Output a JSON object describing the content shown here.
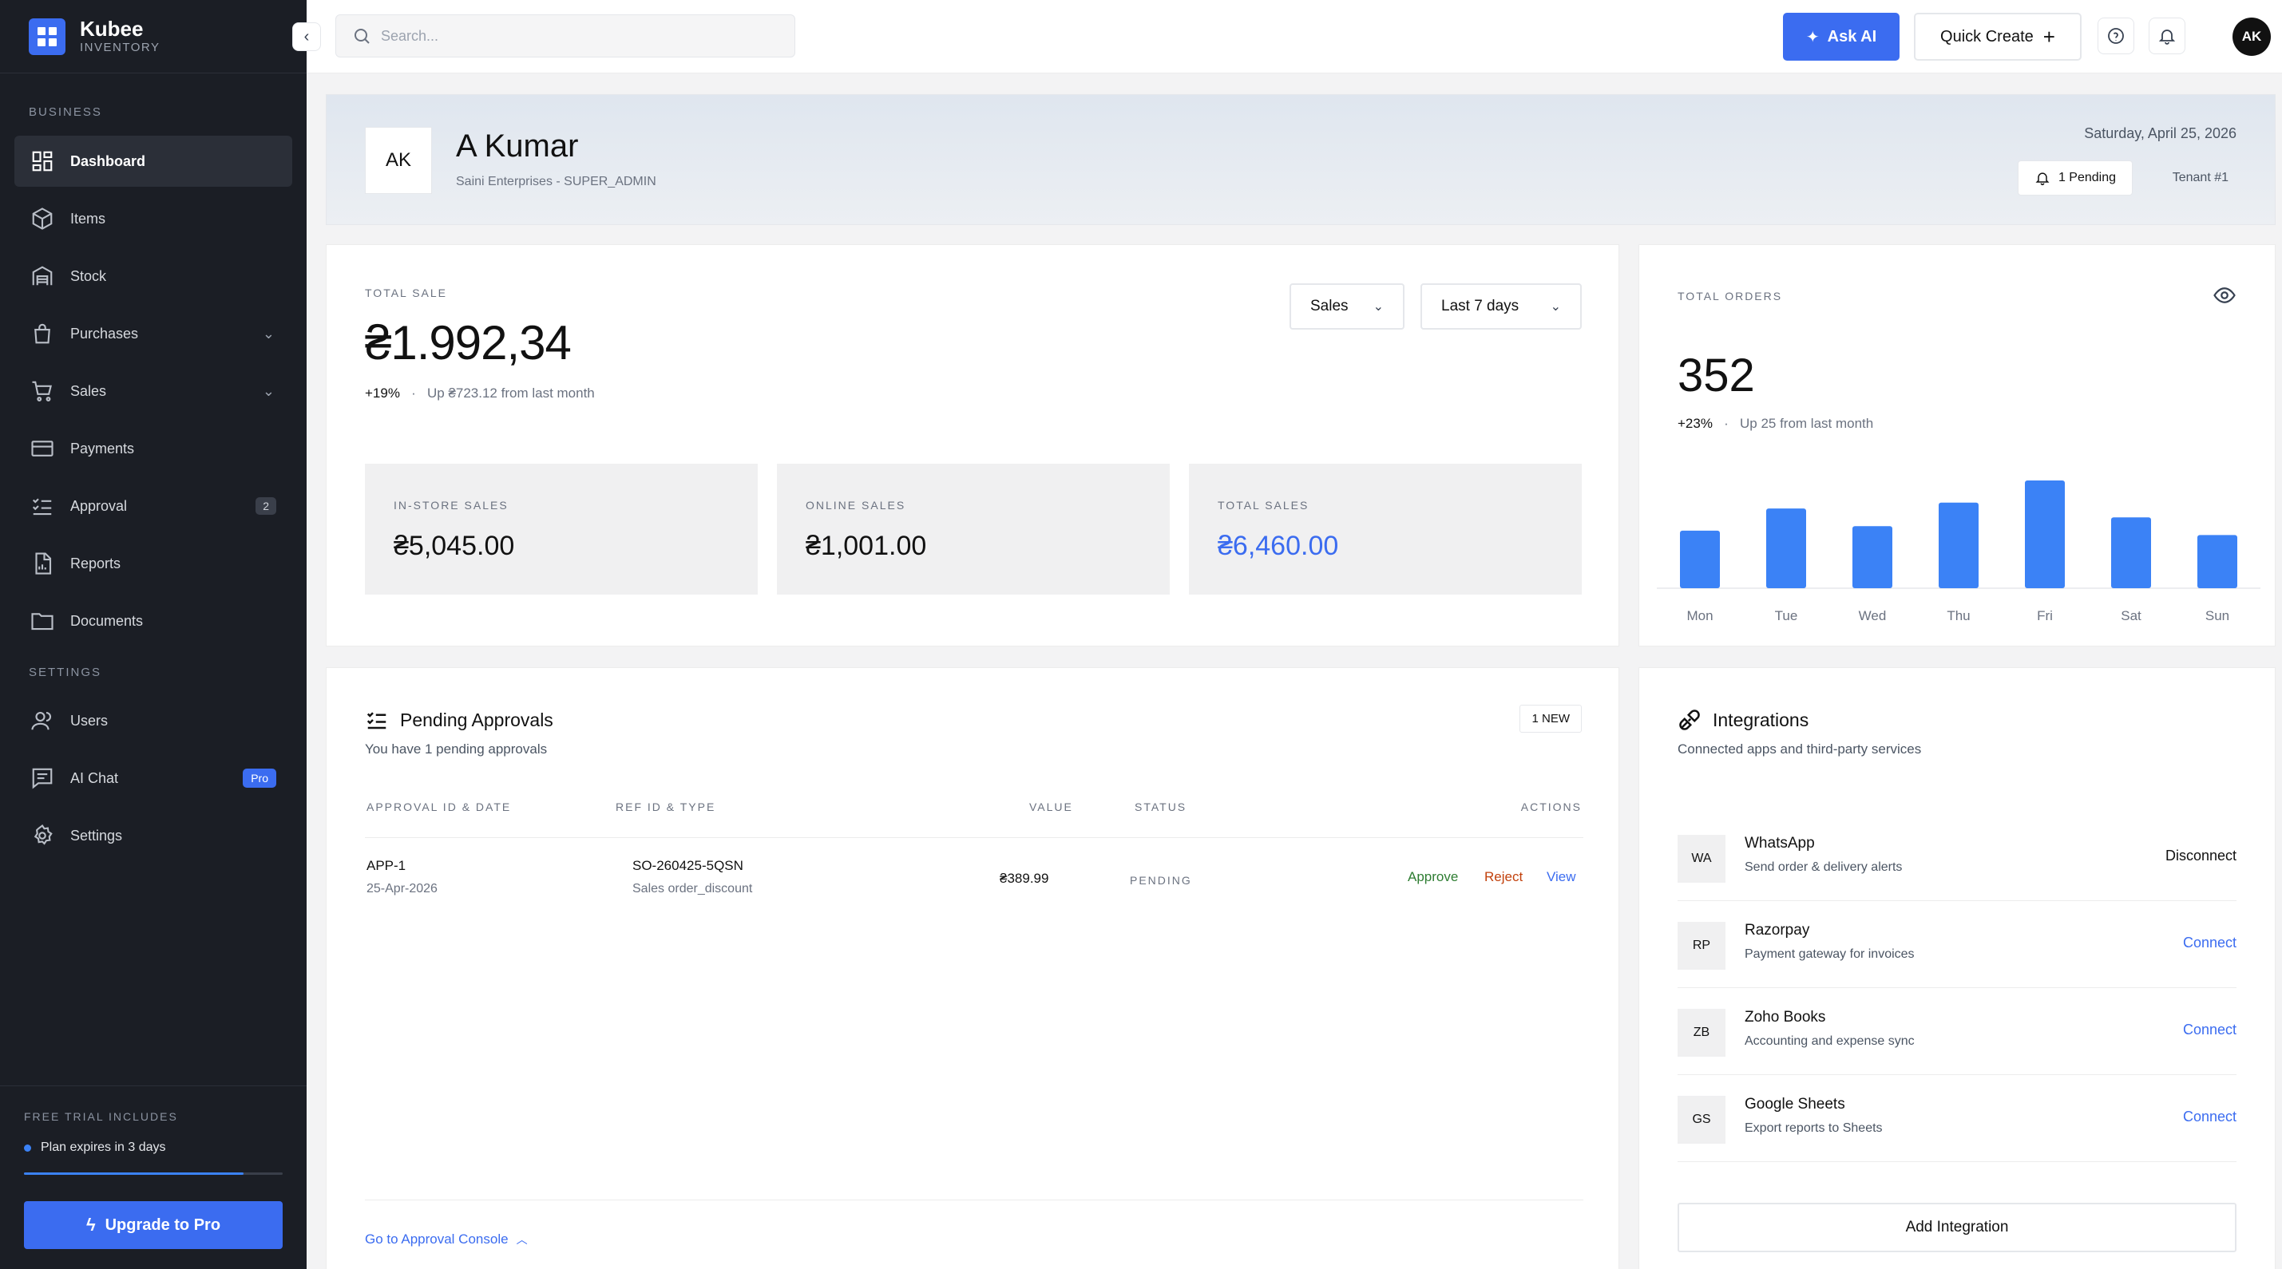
{
  "brand": {
    "name": "Kubee",
    "sub": "INVENTORY"
  },
  "sidebar": {
    "business_label": "BUSINESS",
    "settings_label": "SETTINGS",
    "items": [
      {
        "label": "Dashboard",
        "icon": "dashboard-icon",
        "active": true
      },
      {
        "label": "Items",
        "icon": "box-icon"
      },
      {
        "label": "Stock",
        "icon": "warehouse-icon"
      },
      {
        "label": "Purchases",
        "icon": "bag-icon",
        "expandable": true
      },
      {
        "label": "Sales",
        "icon": "cart-icon",
        "expandable": true
      },
      {
        "label": "Payments",
        "icon": "card-icon"
      },
      {
        "label": "Approval",
        "icon": "checklist-icon",
        "badge": "2"
      },
      {
        "label": "Reports",
        "icon": "report-icon"
      },
      {
        "label": "Documents",
        "icon": "folder-icon"
      }
    ],
    "settings_items": [
      {
        "label": "Users",
        "icon": "users-icon"
      },
      {
        "label": "AI Chat",
        "icon": "chat-icon",
        "badge": "Pro"
      },
      {
        "label": "Settings",
        "icon": "gear-icon"
      }
    ],
    "trial": {
      "label": "FREE TRIAL INCLUDES",
      "text": "Plan expires in 3 days",
      "progress": 0.85
    },
    "upgrade_label": "Upgrade to Pro"
  },
  "topbar": {
    "search_placeholder": "Search...",
    "ask_ai_label": "Ask AI",
    "quick_create_label": "Quick Create",
    "avatar_initials": "AK"
  },
  "profile": {
    "initials": "AK",
    "name": "A Kumar",
    "subtitle": "Saini Enterprises - SUPER_ADMIN",
    "date": "Saturday, April 25, 2026",
    "pending_label": "1 Pending",
    "tenant_label": "Tenant #1"
  },
  "total_sale": {
    "label": "TOTAL SALE",
    "amount": "₴1.992,34",
    "delta_pct": "+19%",
    "delta_text": "Up ₴723.12 from last month",
    "filter_type": "Sales",
    "filter_range": "Last 7 days",
    "breakdown": [
      {
        "label": "IN-STORE SALES",
        "value": "₴5,045.00"
      },
      {
        "label": "ONLINE SALES",
        "value": "₴1,001.00"
      },
      {
        "label": "TOTAL SALES",
        "value": "₴6,460.00",
        "accent": true
      }
    ]
  },
  "total_orders": {
    "label": "TOTAL ORDERS",
    "count": "352",
    "delta_pct": "+23%",
    "delta_text": "Up 25 from last month"
  },
  "chart_data": {
    "type": "bar",
    "categories": [
      "Mon",
      "Tue",
      "Wed",
      "Thu",
      "Fri",
      "Sat",
      "Sun"
    ],
    "values": [
      39,
      54,
      42,
      58,
      73,
      48,
      36
    ],
    "ylim": [
      0,
      80
    ],
    "color": "#3b82f6",
    "title": "",
    "xlabel": "",
    "ylabel": "",
    "grid": false
  },
  "approvals": {
    "title": "Pending Approvals",
    "subtitle": "You have 1 pending approvals",
    "badge": "1 NEW",
    "columns": [
      "APPROVAL ID & DATE",
      "REF ID & TYPE",
      "VALUE",
      "STATUS",
      "ACTIONS"
    ],
    "rows": [
      {
        "id": "APP-1",
        "date": "25-Apr-2026",
        "ref": "SO-260425-5QSN",
        "type": "Sales order_discount",
        "value": "₴389.99",
        "status": "PENDING",
        "approve": "Approve",
        "reject": "Reject",
        "view": "View"
      }
    ],
    "console_link": "Go to Approval Console"
  },
  "integrations": {
    "title": "Integrations",
    "subtitle": "Connected apps and third-party services",
    "items": [
      {
        "abbr": "WA",
        "name": "WhatsApp",
        "desc": "Send order & delivery alerts",
        "action": "Disconnect"
      },
      {
        "abbr": "RP",
        "name": "Razorpay",
        "desc": "Payment gateway for invoices",
        "action": "Connect"
      },
      {
        "abbr": "ZB",
        "name": "Zoho Books",
        "desc": "Accounting and expense sync",
        "action": "Connect"
      },
      {
        "abbr": "GS",
        "name": "Google Sheets",
        "desc": "Export reports to Sheets",
        "action": "Connect"
      }
    ],
    "add_label": "Add Integration"
  },
  "colors": {
    "accent": "#3b6cf0",
    "sidebar_bg": "#1b1e25",
    "approve": "#2e7d32",
    "reject": "#c2410c"
  }
}
